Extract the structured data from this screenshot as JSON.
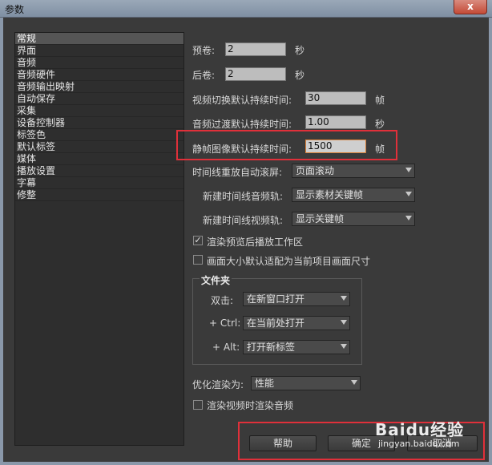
{
  "window": {
    "title": "参数",
    "close": "x"
  },
  "sidebar": {
    "items": [
      {
        "label": "常规"
      },
      {
        "label": "界面"
      },
      {
        "label": "音频"
      },
      {
        "label": "音频硬件"
      },
      {
        "label": "音频输出映射"
      },
      {
        "label": "自动保存"
      },
      {
        "label": "采集"
      },
      {
        "label": "设备控制器"
      },
      {
        "label": "标签色"
      },
      {
        "label": "默认标签"
      },
      {
        "label": "媒体"
      },
      {
        "label": "播放设置"
      },
      {
        "label": "字幕"
      },
      {
        "label": "修整"
      }
    ],
    "selected_index": 0
  },
  "settings": {
    "preroll": {
      "label": "预卷:",
      "value": "2",
      "unit": "秒"
    },
    "postroll": {
      "label": "后卷:",
      "value": "2",
      "unit": "秒"
    },
    "video_transition": {
      "label": "视频切换默认持续时间:",
      "value": "30",
      "unit": "帧"
    },
    "audio_transition": {
      "label": "音频过渡默认持续时间:",
      "value": "1.00",
      "unit": "秒"
    },
    "still_image": {
      "label": "静帧图像默认持续时间:",
      "value": "1500",
      "unit": "帧"
    },
    "timeline_scroll": {
      "label": "时间线重放自动滚屏:",
      "value": "页面滚动"
    },
    "new_audio_track": {
      "label": "新建时间线音频轨:",
      "value": "显示素材关键帧"
    },
    "new_video_track": {
      "label": "新建时间线视频轨:",
      "value": "显示关键帧"
    },
    "render_preview": {
      "label": "渲染预览后播放工作区",
      "checked": true
    },
    "scale_to_frame": {
      "label": "画面大小默认适配为当前项目画面尺寸",
      "checked": false
    },
    "bins": {
      "title": "文件夹",
      "double_click": {
        "label": "双击:",
        "value": "在新窗口打开"
      },
      "ctrl": {
        "label": "+ Ctrl:",
        "value": "在当前处打开"
      },
      "alt": {
        "label": "+ Alt:",
        "value": "打开新标签"
      }
    },
    "optimize_render": {
      "label": "优化渲染为:",
      "value": "性能"
    },
    "render_audio": {
      "label": "渲染视频时渲染音频",
      "checked": false
    }
  },
  "buttons": {
    "help": "帮助",
    "ok": "确定",
    "cancel": "取消"
  },
  "watermark": {
    "logo": "Baidu经验",
    "url": "jingyan.baidu.com"
  },
  "colors": {
    "highlight": "#e0303a",
    "panel": "#3a3a3a",
    "field": "#bdbdbd"
  }
}
